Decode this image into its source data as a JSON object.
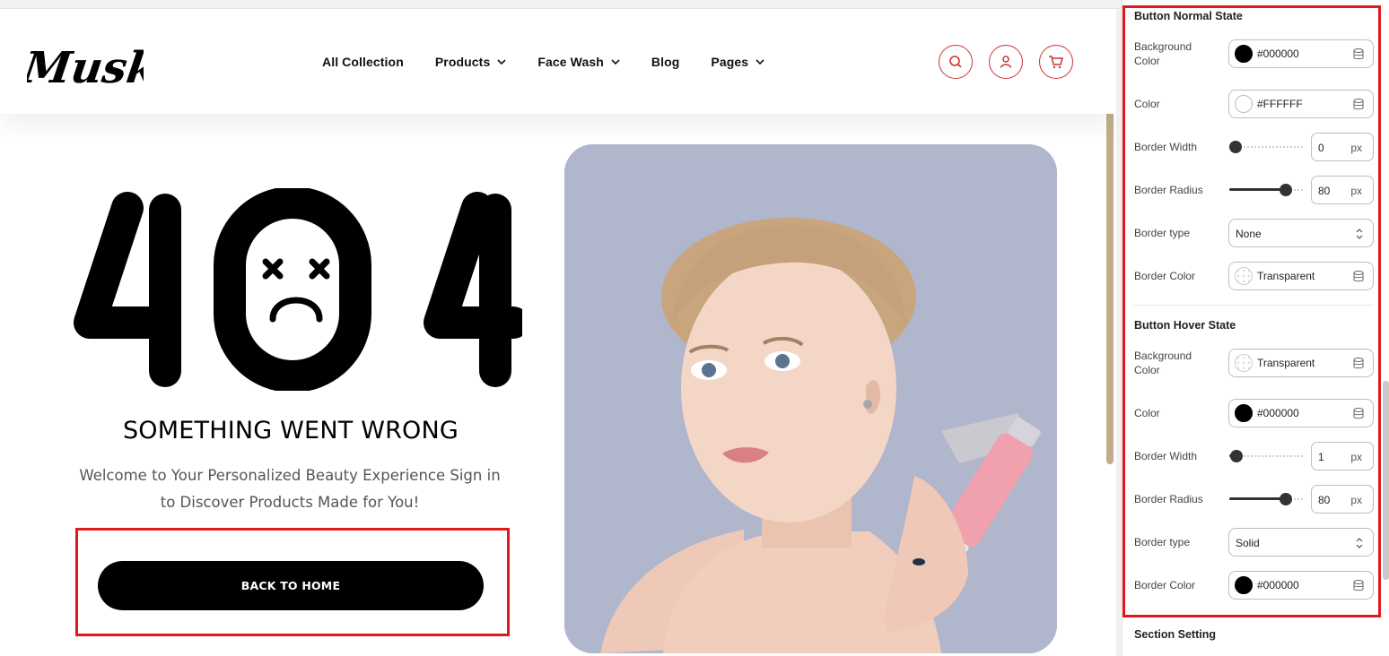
{
  "site": {
    "logo_text": "Musk",
    "nav": [
      {
        "label": "All Collection"
      },
      {
        "label": "Products"
      },
      {
        "label": "Face Wash"
      },
      {
        "label": "Blog"
      },
      {
        "label": "Pages"
      }
    ],
    "icons": [
      "search-icon",
      "user-icon",
      "cart-icon"
    ],
    "accent_color": "#cc3333"
  },
  "error_page": {
    "code": "404",
    "title": "SOMETHING WENT WRONG",
    "message": "Welcome to Your Personalized Beauty Experience Sign in to Discover Products Made for You!",
    "button_label": "BACK TO HOME"
  },
  "panel": {
    "normal": {
      "heading": "Button Normal State",
      "bg_label": "Background Color",
      "bg_value": "#000000",
      "color_label": "Color",
      "color_value": "#FFFFFF",
      "bw_label": "Border Width",
      "bw_value": "0",
      "bw_unit": "px",
      "bw_level": 0,
      "br_label": "Border Radius",
      "br_value": "80",
      "br_unit": "px",
      "br_level": 0.8,
      "bt_label": "Border type",
      "bt_value": "None",
      "bc_label": "Border Color",
      "bc_value": "Transparent"
    },
    "hover": {
      "heading": "Button Hover State",
      "bg_label": "Background Color",
      "bg_value": "Transparent",
      "color_label": "Color",
      "color_value": "#000000",
      "bw_label": "Border Width",
      "bw_value": "1",
      "bw_unit": "px",
      "bw_level": 0.01,
      "br_label": "Border Radius",
      "br_value": "80",
      "br_unit": "px",
      "br_level": 0.8,
      "bt_label": "Border type",
      "bt_value": "Solid",
      "bc_label": "Border Color",
      "bc_value": "#000000"
    },
    "section_heading": "Section Setting",
    "highlight_color": "#e0191c"
  }
}
